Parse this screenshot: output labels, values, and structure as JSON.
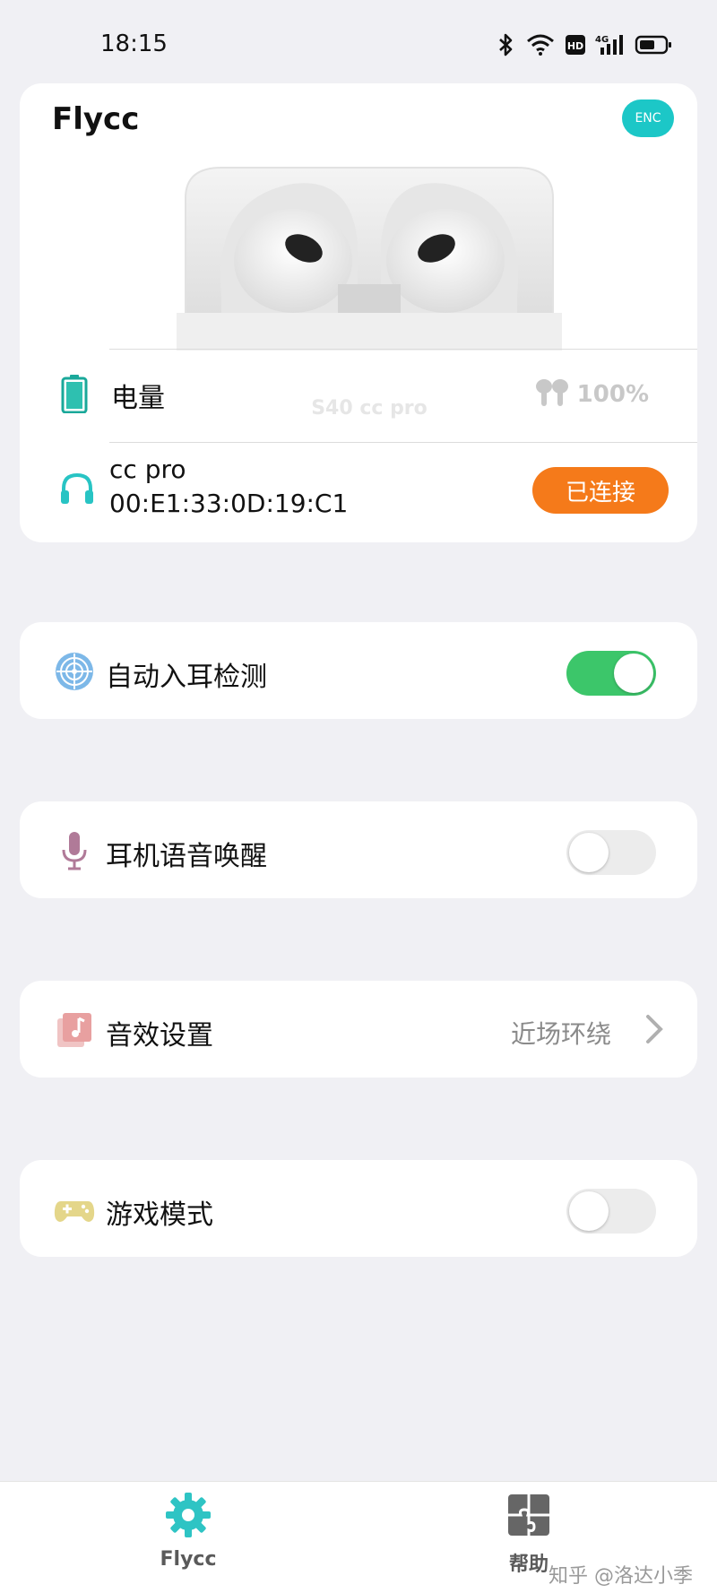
{
  "status_bar": {
    "time": "18:15",
    "icons": [
      "bluetooth-icon",
      "wifi-icon",
      "hd-icon",
      "4g-signal-icon",
      "battery-status-icon"
    ],
    "hd_text": "HD",
    "net_text": "4G"
  },
  "device": {
    "name": "Flycc",
    "badge": "ENC",
    "case_label": "S40 cc pro",
    "battery_label": "电量",
    "battery_value": "100%",
    "connection_name": "cc pro",
    "mac_address": "00:E1:33:0D:19:C1",
    "connected_label": "已连接",
    "accent_color": "#1cc7c7",
    "connected_color": "#f57a1a"
  },
  "settings": {
    "in_ear_detection": {
      "label": "自动入耳检测",
      "on": true
    },
    "voice_wakeup": {
      "label": "耳机语音唤醒",
      "on": false
    },
    "sound_effect": {
      "label": "音效设置",
      "value": "近场环绕"
    },
    "game_mode": {
      "label": "游戏模式",
      "on": false
    }
  },
  "toggle_on_color": "#3cc66a",
  "bottom_nav": {
    "items": [
      {
        "label": "Flycc",
        "icon": "gear-icon"
      },
      {
        "label": "帮助",
        "icon": "puzzle-icon"
      }
    ]
  },
  "watermark": "知乎 @洛达小季"
}
